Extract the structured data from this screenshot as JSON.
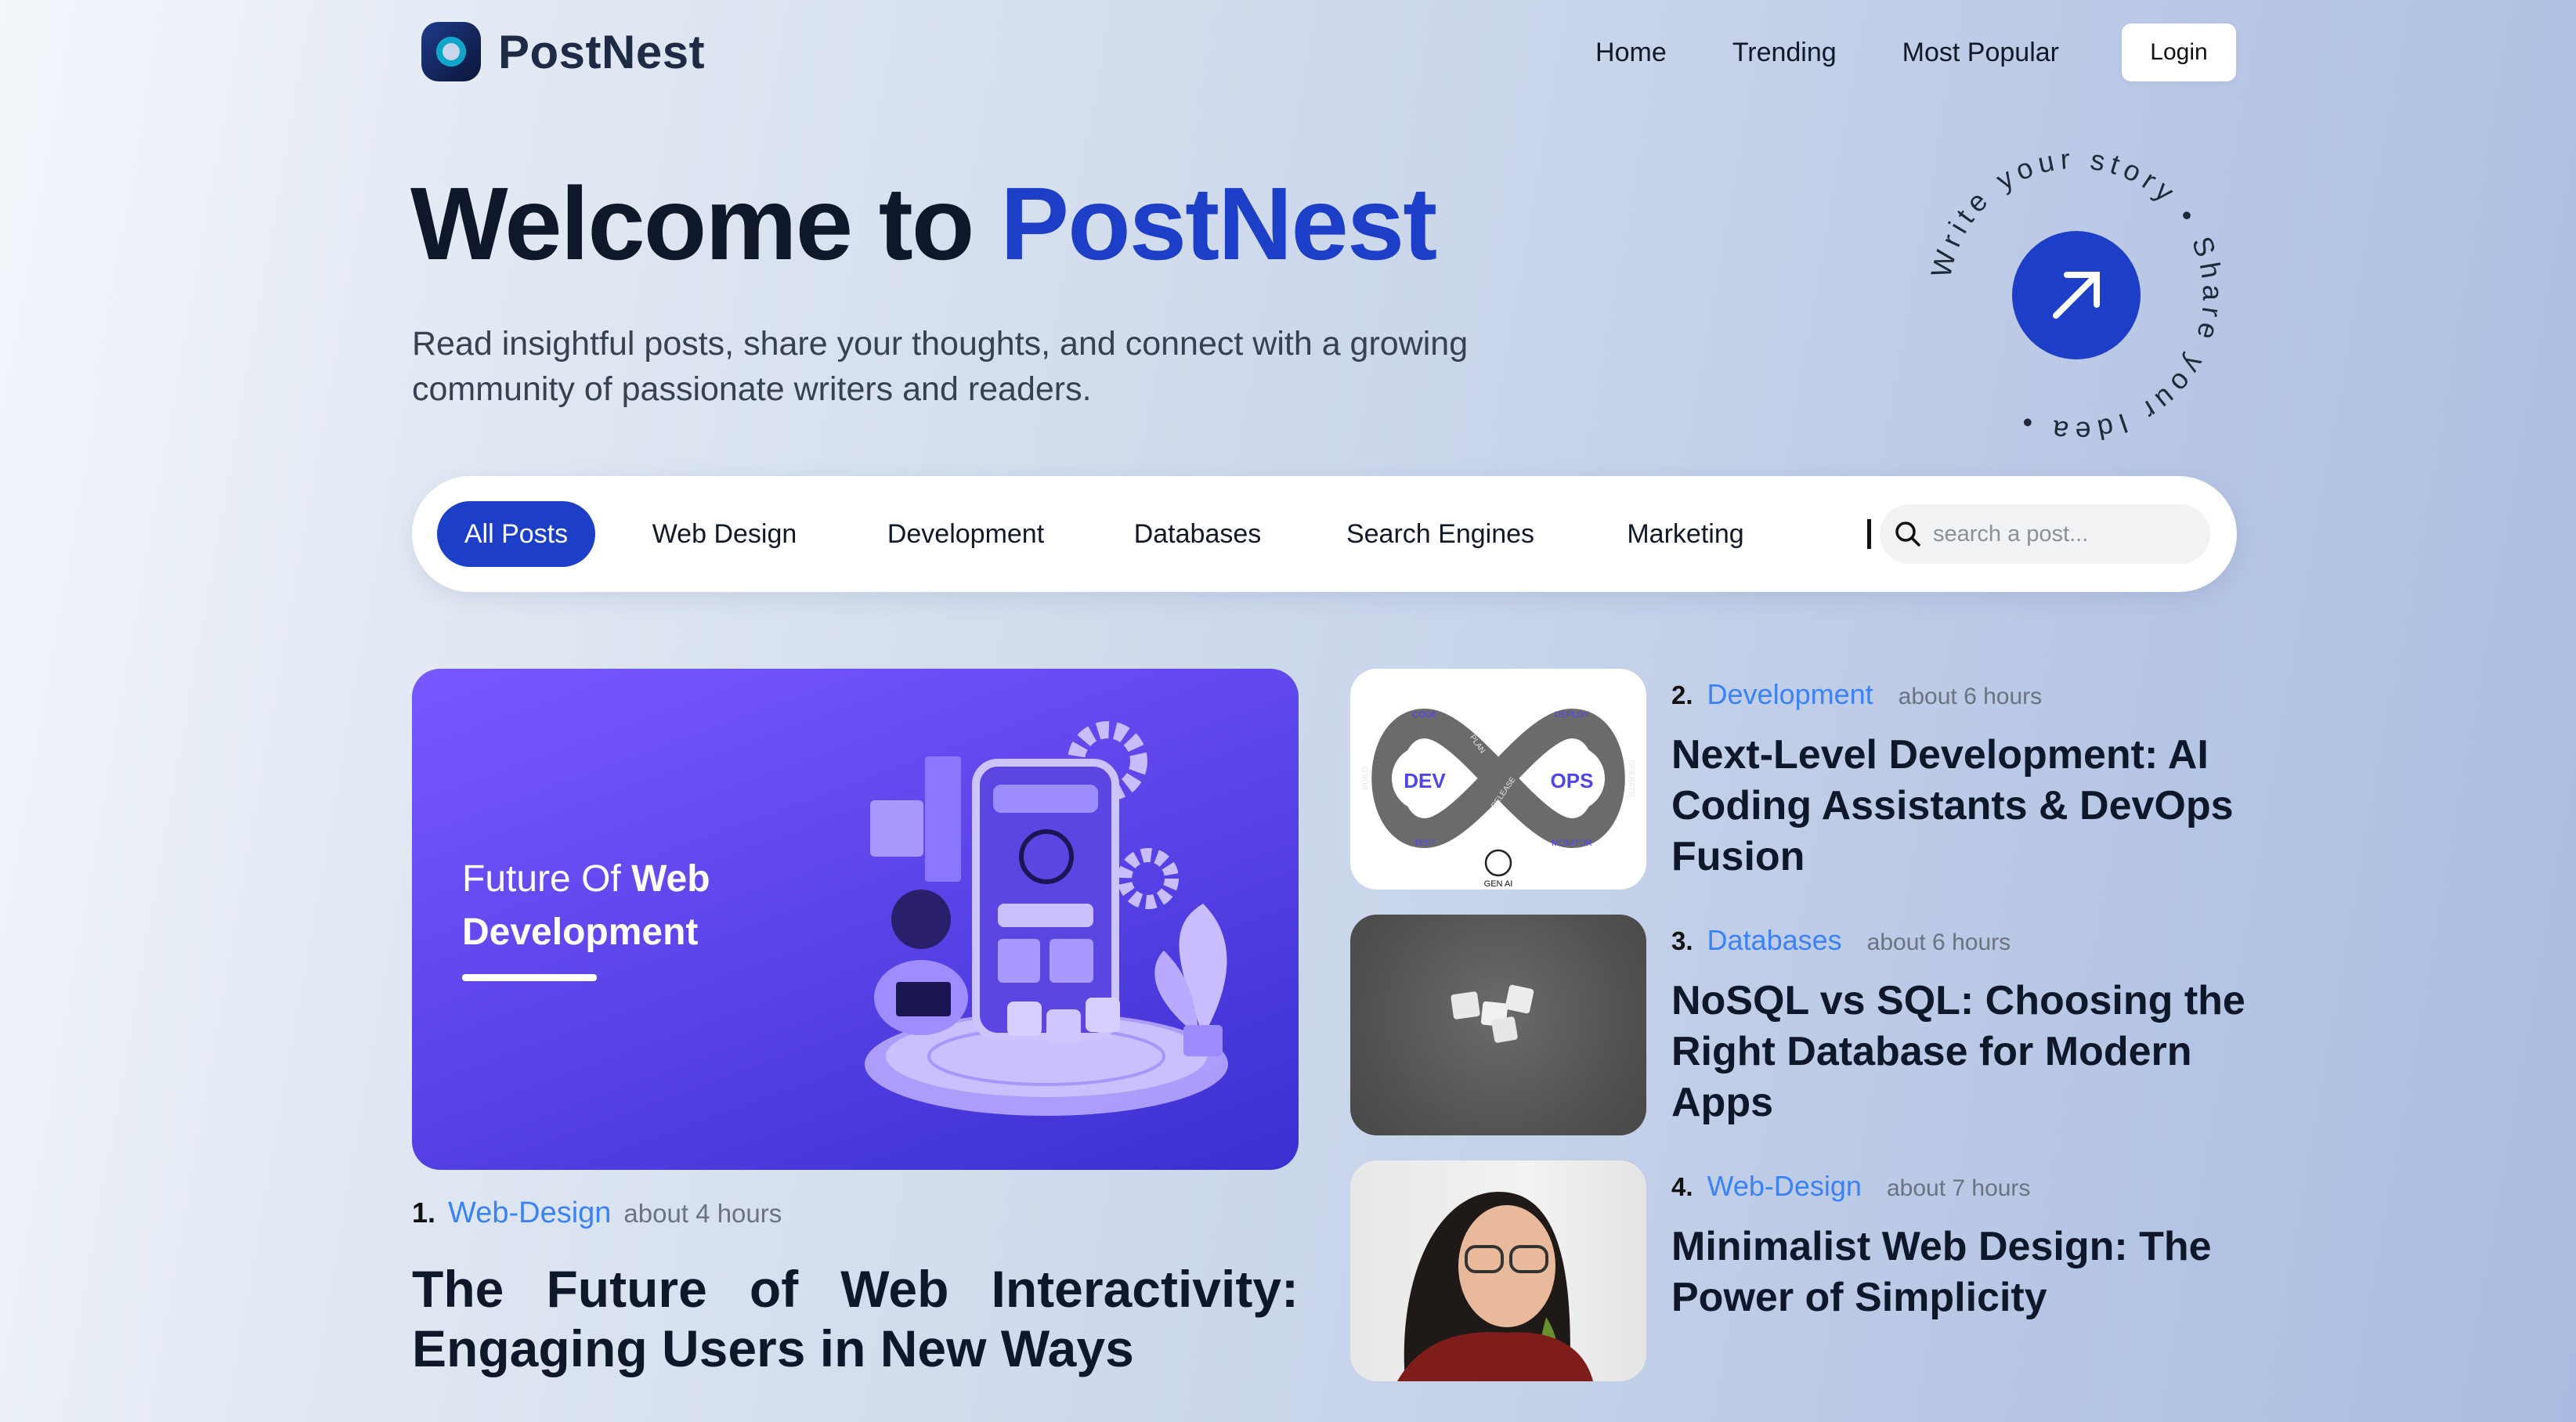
{
  "brand": {
    "name": "PostNest"
  },
  "nav": {
    "home": "Home",
    "trending": "Trending",
    "most_popular": "Most Popular",
    "login": "Login"
  },
  "hero": {
    "title_prefix": "Welcome to ",
    "title_accent": "PostNest",
    "subtitle": "Read insightful posts, share your thoughts, and connect with a growing community of passionate writers and readers.",
    "badge_text": "Write your story • Share your Idea •"
  },
  "filters": {
    "items": [
      "All Posts",
      "Web Design",
      "Development",
      "Databases",
      "Search Engines",
      "Marketing"
    ],
    "active": "All Posts",
    "search_placeholder": "search a post..."
  },
  "featured": {
    "number": "1.",
    "category": "Web-Design",
    "time": "about 4 hours",
    "title": "The Future of Web Interactivity: Engaging Users in New Ways",
    "image_text_regular": "Future Of ",
    "image_text_bold_1": "Web",
    "image_text_bold_2": "Development"
  },
  "posts": [
    {
      "number": "2.",
      "category": "Development",
      "time": "about 6 hours",
      "title": "Next-Level Development: AI Coding Assistants & DevOps Fusion",
      "image_labels": {
        "dev": "DEV",
        "ops": "OPS",
        "code": "CODE",
        "deploy": "DEPLOY",
        "build": "BUILD",
        "test": "TEST",
        "monitor": "MONITOR",
        "operate": "OPERATE",
        "plan": "PLAN",
        "release": "RELEASE",
        "gen_ai": "GEN AI"
      }
    },
    {
      "number": "3.",
      "category": "Databases",
      "time": "about 6 hours",
      "title": "NoSQL vs SQL: Choosing the Right Database for Modern Apps"
    },
    {
      "number": "4.",
      "category": "Web-Design",
      "time": "about 7 hours",
      "title": "Minimalist Web Design: The Power of Simplicity"
    }
  ],
  "colors": {
    "accent": "#1d3fc7",
    "category_link": "#3b82f6",
    "feature_bg": "#5a44e8"
  }
}
